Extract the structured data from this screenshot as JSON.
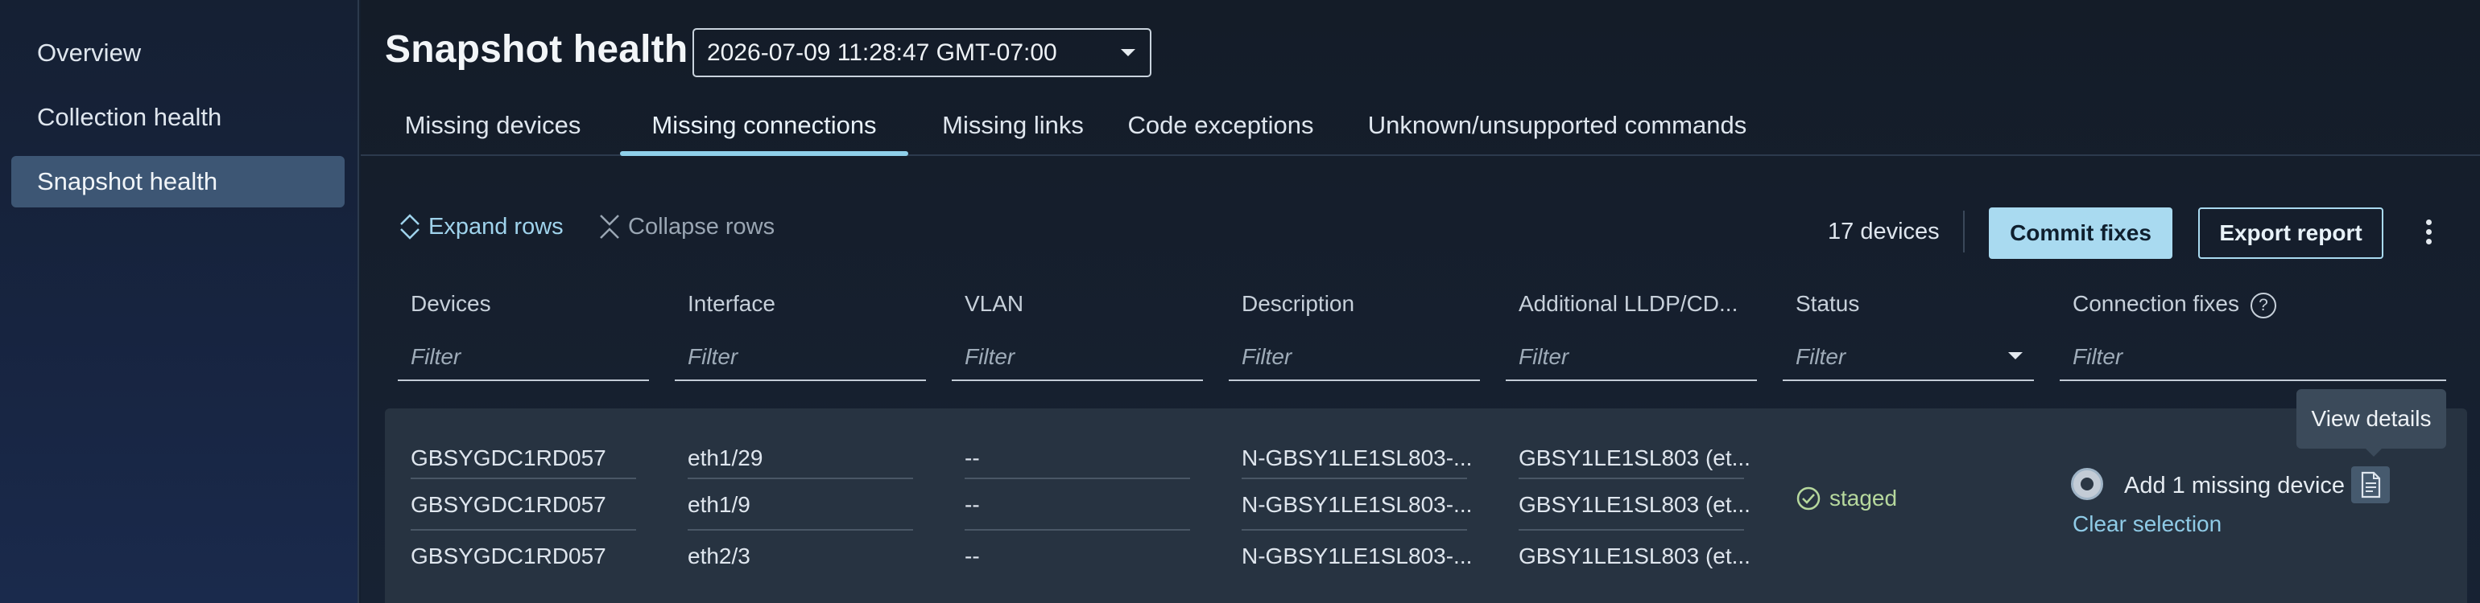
{
  "sidebar": {
    "items": [
      {
        "label": "Overview"
      },
      {
        "label": "Collection health"
      },
      {
        "label": "Snapshot health"
      }
    ]
  },
  "header": {
    "title": "Snapshot health",
    "snapshot_select": "2026-07-09 11:28:47 GMT-07:00"
  },
  "tabs": [
    {
      "label": "Missing devices"
    },
    {
      "label": "Missing connections",
      "active": true
    },
    {
      "label": "Missing links"
    },
    {
      "label": "Code exceptions"
    },
    {
      "label": "Unknown/unsupported commands"
    }
  ],
  "toolbar": {
    "expand_label": "Expand rows",
    "collapse_label": "Collapse rows",
    "count": "17 devices",
    "commit_label": "Commit fixes",
    "export_label": "Export report"
  },
  "table": {
    "columns": [
      "Devices",
      "Interface",
      "VLAN",
      "Description",
      "Additional LLDP/CD...",
      "Status",
      "Connection fixes"
    ],
    "filter_placeholder": "Filter",
    "rows": [
      [
        "GBSYGDC1RD057",
        "eth1/29",
        "--",
        "N-GBSY1LE1SL803-...",
        "GBSY1LE1SL803 (et..."
      ],
      [
        "GBSYGDC1RD057",
        "eth1/9",
        "--",
        "N-GBSY1LE1SL803-...",
        "GBSY1LE1SL803 (et..."
      ],
      [
        "GBSYGDC1RD057",
        "eth2/3",
        "--",
        "N-GBSY1LE1SL803-...",
        "GBSY1LE1SL803 (et..."
      ]
    ],
    "group_status": "staged",
    "fix_label": "Add 1 missing device",
    "clear_selection": "Clear selection",
    "tooltip": "View details"
  },
  "colors": {
    "accent": "#a9daf0",
    "active_tab": "#8fd0ea",
    "staged": "#b6d89d",
    "link": "#8fcbe6"
  },
  "icons": [
    "expand-icon",
    "collapse-icon",
    "kebab-menu-icon",
    "help-icon",
    "check-circle-icon",
    "document-icon",
    "chevron-down-icon"
  ]
}
